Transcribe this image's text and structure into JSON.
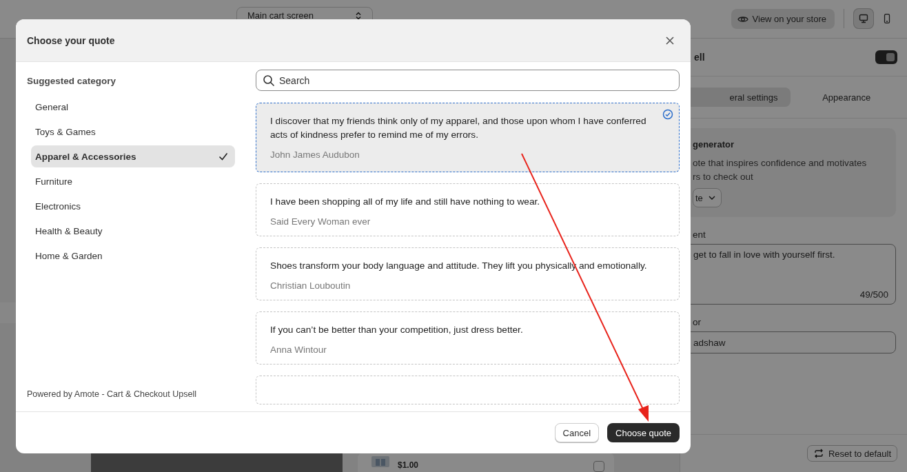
{
  "background": {
    "screen_select": "Main cart screen",
    "view_store_button": "View on your store",
    "devices": [
      {
        "kind": "desktop",
        "selected": true
      },
      {
        "kind": "mobile",
        "selected": false
      }
    ],
    "panel": {
      "title": "ell",
      "enabled": true,
      "tabs": [
        {
          "label": "eral settings",
          "selected": true
        },
        {
          "label": "Appearance",
          "selected": false
        }
      ],
      "generator": {
        "title": "generator",
        "description_lines": [
          "ote that inspires confidence and motivates",
          "rs to check out"
        ],
        "dropdown": "te"
      },
      "content_label": "ent",
      "content_value": "get to fall in love with yourself first.",
      "counter": "49/500",
      "author_label": "or",
      "author_value": "adshaw",
      "reset_button": "Reset to default"
    },
    "preview": {
      "price": "$1.00",
      "checked": false
    }
  },
  "modal": {
    "title": "Choose your quote",
    "sidebar_heading": "Suggested category",
    "categories": [
      {
        "label": "General",
        "selected": false
      },
      {
        "label": "Toys & Games",
        "selected": false
      },
      {
        "label": "Apparel & Accessories",
        "selected": true
      },
      {
        "label": "Furniture",
        "selected": false
      },
      {
        "label": "Electronics",
        "selected": false
      },
      {
        "label": "Health & Beauty",
        "selected": false
      },
      {
        "label": "Home & Garden",
        "selected": false
      }
    ],
    "footer_note": "Powered by Amote - Cart & Checkout Upsell",
    "search": {
      "placeholder": "Search"
    },
    "quotes": [
      {
        "text": "I discover that my friends think only of my apparel, and those upon whom I have conferred acts of kindness prefer to remind me of my errors.",
        "author": "John James Audubon",
        "selected": true
      },
      {
        "text": "I have been shopping all of my life and still have nothing to wear.",
        "author": "Said Every Woman ever",
        "selected": false
      },
      {
        "text": "Shoes transform your body language and attitude. They lift you physically and emotionally.",
        "author": "Christian Louboutin",
        "selected": false
      },
      {
        "text": "If you can’t be better than your competition, just dress better.",
        "author": "Anna Wintour",
        "selected": false
      }
    ],
    "cancel_button": "Cancel",
    "confirm_button": "Choose quote"
  }
}
